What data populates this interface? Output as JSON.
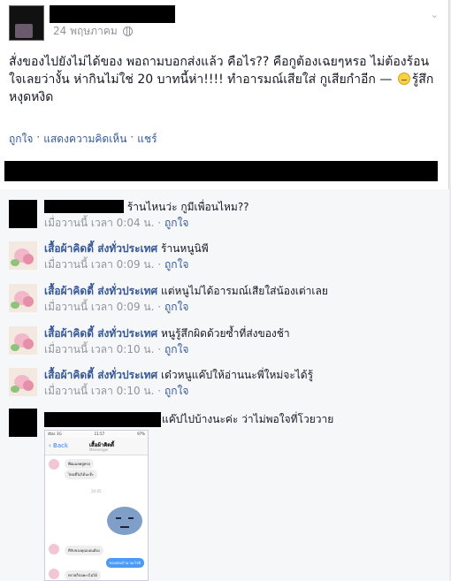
{
  "post": {
    "time": "24 พฤษภาคม",
    "text": "สั่งของไปยังไม่ได้ของ พอถามบอกส่งแล้ว คือไร?? คือกูต้องเฉยๆหรอ ไม่ต้องร้อนใจเลยว่างั้น ห่ากินไม่ใช่ 20 บาทนี้ห่า!!!! ทำอารมณ์เสียใส่ กูเสียกำอีก",
    "feeling_prefix": "—",
    "feeling": "รู้สึกหงุดหงิด",
    "actions": [
      "ถูกใจ",
      "แสดงความคิดเห็น",
      "แชร์"
    ],
    "separator": "·"
  },
  "comments": [
    {
      "name": "",
      "text": "ร้านไหนว่ะ กูมีเพื่อนไหม??",
      "time": "เมื่อวานนี้ เวลา 0:04 น.",
      "like": "ถูกใจ"
    },
    {
      "name": "เสื้อผ้าคิดดี้ ส่งทั่วประเทศ",
      "text": "ร้านหนูนิพี",
      "time": "เมื่อวานนี้ เวลา 0:09 น.",
      "like": "ถูกใจ"
    },
    {
      "name": "เสื้อผ้าคิดดี้ ส่งทั่วประเทศ",
      "text": "แต่หนูไม่ได้อารมณ์เสียใส่น้องเต่าเลย",
      "time": "เมื่อวานนี้ เวลา 0:09 น.",
      "like": "ถูกใจ"
    },
    {
      "name": "เสื้อผ้าคิดดี้ ส่งทั่วประเทศ",
      "text": "หนูรู้สึกผิดด้วยซ้ำที่ส่งของช้า",
      "time": "เมื่อวานนี้ เวลา 0:10 น.",
      "like": "ถูกใจ"
    },
    {
      "name": "เสื้อผ้าคิดดี้ ส่งทั่วประเทศ",
      "text": "เด๋วหนูแค๊ปให้อ่านนะพี่ใหม่จะได้รู้",
      "time": "เมื่อวานนี้ เวลา 0:10 น.",
      "like": "ถูกใจ"
    }
  ],
  "last_comment": {
    "text": "แค๊ปไปบ้างนะค่ะ ว่าไม่พอใจที่โวยวาย",
    "screenshot": {
      "carrier": "dtac 3G",
      "clock": "11:57",
      "battery": "97%",
      "back": "Back",
      "title": "เสื้อผ้าคิดดี้",
      "subtitle": "Messenger",
      "messages": [
        "พี่ผมแลคยูหรอ",
        "ไหนที่ไม่ได้นะจ๊ะ",
        "ที่กับของคุณบอนต้อง",
        "ทรายก็กอคะรฺไม่ได้"
      ],
      "time_label": "20:05",
      "reply": "ของสอบกำมาอะไรคิ"
    }
  }
}
